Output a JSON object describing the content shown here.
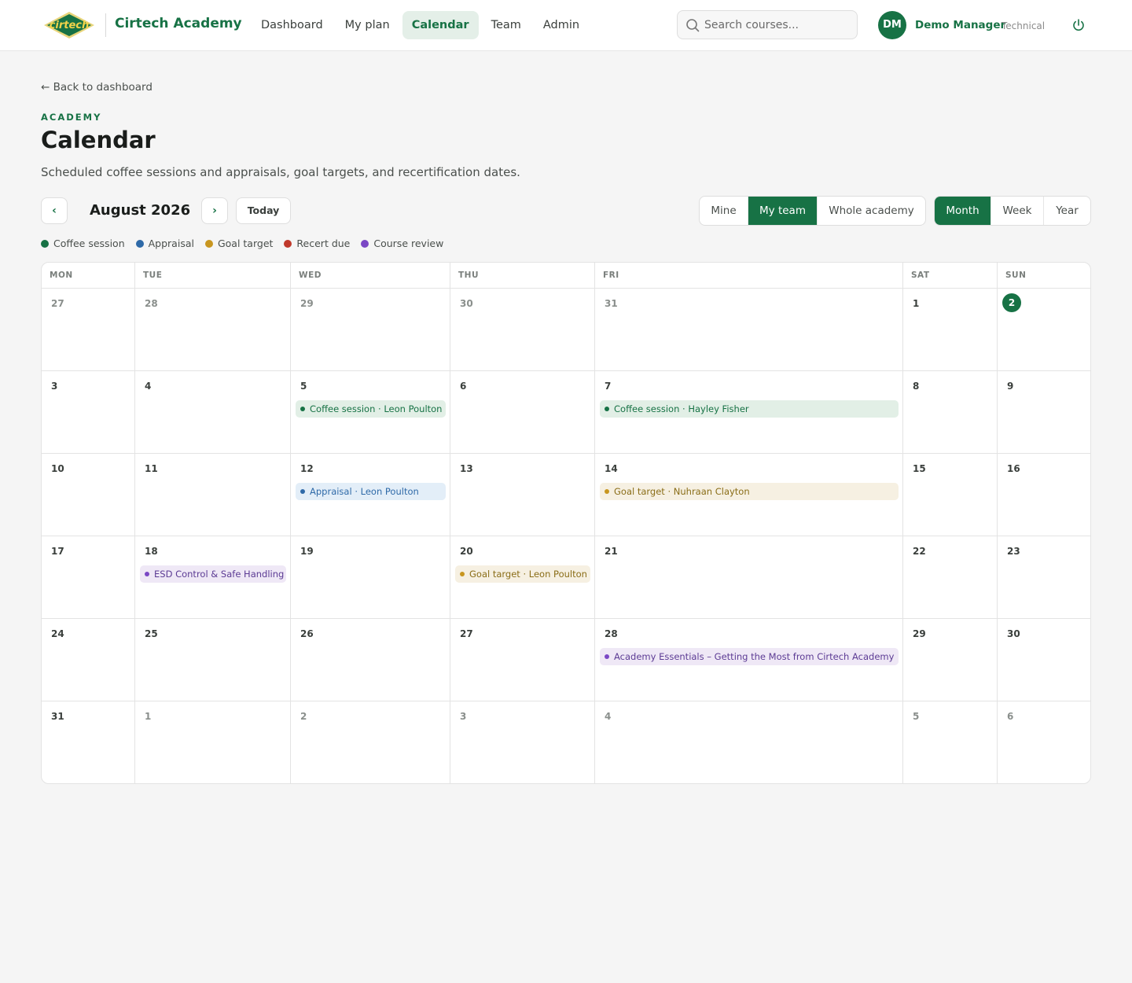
{
  "header": {
    "logo_text": "cirtech",
    "brand": "Cirtech Academy",
    "nav": [
      "Dashboard",
      "My plan",
      "Calendar",
      "Team",
      "Admin"
    ],
    "active_nav": "Calendar",
    "search_placeholder": "Search courses...",
    "user": {
      "initials": "DM",
      "name": "Demo Manager",
      "role": "Technical"
    }
  },
  "page": {
    "back_link": "← Back to dashboard",
    "eyebrow": "ACADEMY",
    "title": "Calendar",
    "subtitle": "Scheduled coffee sessions and appraisals, goal targets, and recertification dates."
  },
  "toolbar": {
    "prev": "‹",
    "next": "›",
    "month": "August 2026",
    "today": "Today",
    "scope_options": [
      "Mine",
      "My team",
      "Whole academy"
    ],
    "scope_active": "My team",
    "view_options": [
      "Month",
      "Week",
      "Year"
    ],
    "view_active": "Month"
  },
  "legend": [
    {
      "label": "Coffee session",
      "color": "#177245"
    },
    {
      "label": "Appraisal",
      "color": "#2f6aa8"
    },
    {
      "label": "Goal target",
      "color": "#c8961f"
    },
    {
      "label": "Recert due",
      "color": "#c0392b"
    },
    {
      "label": "Course review",
      "color": "#7b47c5"
    }
  ],
  "calendar": {
    "weekdays": [
      "MON",
      "TUE",
      "WED",
      "THU",
      "FRI",
      "SAT",
      "SUN"
    ],
    "weeks": [
      [
        {
          "d": "27",
          "muted": true
        },
        {
          "d": "28",
          "muted": true
        },
        {
          "d": "29",
          "muted": true
        },
        {
          "d": "30",
          "muted": true
        },
        {
          "d": "31",
          "muted": true
        },
        {
          "d": "1"
        },
        {
          "d": "2",
          "today": true
        }
      ],
      [
        {
          "d": "3"
        },
        {
          "d": "4"
        },
        {
          "d": "5",
          "event": {
            "type": "coffee",
            "label": "Coffee session · Leon Poulton"
          }
        },
        {
          "d": "6"
        },
        {
          "d": "7",
          "event": {
            "type": "coffee",
            "label": "Coffee session · Hayley Fisher"
          }
        },
        {
          "d": "8"
        },
        {
          "d": "9"
        }
      ],
      [
        {
          "d": "10"
        },
        {
          "d": "11"
        },
        {
          "d": "12",
          "event": {
            "type": "appraisal",
            "label": "Appraisal · Leon Poulton"
          }
        },
        {
          "d": "13"
        },
        {
          "d": "14",
          "event": {
            "type": "goal",
            "label": "Goal target · Nuhraan Clayton"
          }
        },
        {
          "d": "15"
        },
        {
          "d": "16"
        }
      ],
      [
        {
          "d": "17"
        },
        {
          "d": "18",
          "event": {
            "type": "review",
            "label": "ESD Control & Safe Handling"
          }
        },
        {
          "d": "19"
        },
        {
          "d": "20",
          "event": {
            "type": "goal",
            "label": "Goal target · Leon Poulton"
          }
        },
        {
          "d": "21"
        },
        {
          "d": "22"
        },
        {
          "d": "23"
        }
      ],
      [
        {
          "d": "24"
        },
        {
          "d": "25"
        },
        {
          "d": "26"
        },
        {
          "d": "27"
        },
        {
          "d": "28",
          "event": {
            "type": "review",
            "label": "Academy Essentials – Getting the Most from Cirtech Academy"
          }
        },
        {
          "d": "29"
        },
        {
          "d": "30"
        }
      ],
      [
        {
          "d": "31"
        },
        {
          "d": "1",
          "muted": true
        },
        {
          "d": "2",
          "muted": true
        },
        {
          "d": "3",
          "muted": true
        },
        {
          "d": "4",
          "muted": true
        },
        {
          "d": "5",
          "muted": true
        },
        {
          "d": "6",
          "muted": true
        }
      ]
    ]
  }
}
